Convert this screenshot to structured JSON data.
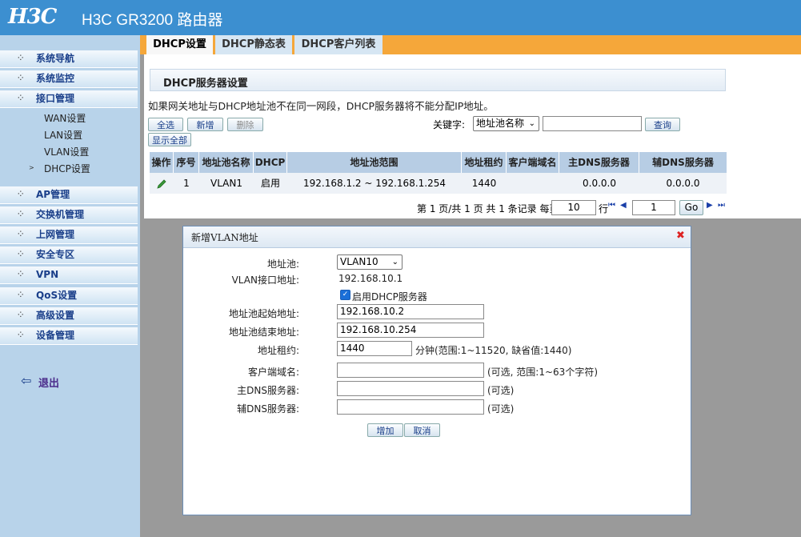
{
  "header": {
    "logo": "H3C",
    "title": "H3C GR3200 路由器"
  },
  "tabs": [
    {
      "label": "DHCP设置"
    },
    {
      "label": "DHCP静态表"
    },
    {
      "label": "DHCP客户列表"
    }
  ],
  "sidebar": {
    "items": [
      {
        "label": "系统导航"
      },
      {
        "label": "系统监控"
      },
      {
        "label": "接口管理"
      },
      {
        "label": "AP管理"
      },
      {
        "label": "交换机管理"
      },
      {
        "label": "上网管理"
      },
      {
        "label": "安全专区"
      },
      {
        "label": "VPN"
      },
      {
        "label": "QoS设置"
      },
      {
        "label": "高级设置"
      },
      {
        "label": "设备管理"
      }
    ],
    "subitems": [
      {
        "label": "WAN设置"
      },
      {
        "label": "LAN设置"
      },
      {
        "label": "VLAN设置"
      },
      {
        "label": "DHCP设置"
      }
    ],
    "logout": "退出"
  },
  "section": {
    "title": "DHCP服务器设置",
    "notice": "如果网关地址与DHCP地址池不在同一网段，DHCP服务器将不能分配IP地址。"
  },
  "toolbar": {
    "select_all": "全选",
    "add": "新增",
    "delete": "删除",
    "show_all": "显示全部",
    "keyword_label": "关键字:",
    "keyword_select": "地址池名称",
    "search_value": "",
    "search": "查询"
  },
  "table": {
    "headers": [
      "操作",
      "序号",
      "地址池名称",
      "DHCP",
      "地址池范围",
      "地址租约",
      "客户端域名",
      "主DNS服务器",
      "辅DNS服务器"
    ],
    "rows": [
      {
        "index": "1",
        "name": "VLAN1",
        "dhcp": "启用",
        "range": "192.168.1.2 ~ 192.168.1.254",
        "lease": "1440",
        "domain": "",
        "dns1": "0.0.0.0",
        "dns2": "0.0.0.0"
      }
    ]
  },
  "pager": {
    "text": "第 1 页/共 1 页 共 1 条记录 每页",
    "per_page": "10",
    "row_label": "行",
    "page": "1",
    "go": "Go"
  },
  "dialog": {
    "title": "新增VLAN地址",
    "pool_label": "地址池:",
    "pool_value": "VLAN10",
    "vlan_if_label": "VLAN接口地址:",
    "vlan_if_value": "192.168.10.1",
    "enable_dhcp": "启用DHCP服务器",
    "start_label": "地址池起始地址:",
    "start_value": "192.168.10.2",
    "end_label": "地址池结束地址:",
    "end_value": "192.168.10.254",
    "lease_label": "地址租约:",
    "lease_value": "1440",
    "lease_hint": "分钟(范围:1~11520, 缺省值:1440)",
    "domain_label": "客户端域名:",
    "domain_value": "",
    "domain_hint": "(可选, 范围:1~63个字符)",
    "dns1_label": "主DNS服务器:",
    "dns1_value": "",
    "dns1_hint": "(可选)",
    "dns2_label": "辅DNS服务器:",
    "dns2_value": "",
    "dns2_hint": "(可选)",
    "add": "增加",
    "cancel": "取消"
  }
}
